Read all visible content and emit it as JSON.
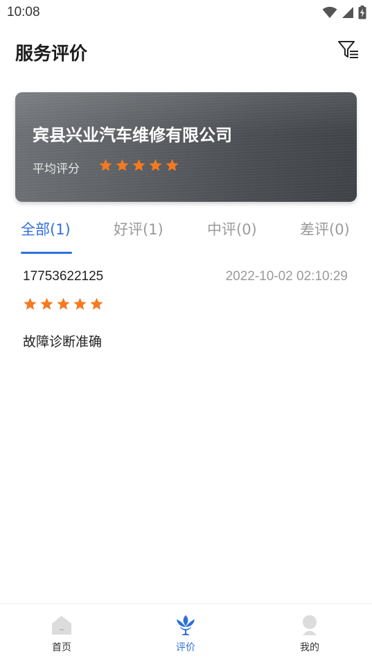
{
  "status_bar": {
    "time": "10:08"
  },
  "header": {
    "title": "服务评价",
    "filter_icon": "filter-icon"
  },
  "store": {
    "name": "宾县兴业汽车维修有限公司",
    "avg_label": "平均评分",
    "rating": 5,
    "max_rating": 5
  },
  "tabs": [
    {
      "label": "全部(1)",
      "active": true
    },
    {
      "label": "好评(1)",
      "active": false
    },
    {
      "label": "中评(0)",
      "active": false
    },
    {
      "label": "差评(0)",
      "active": false
    }
  ],
  "reviews": [
    {
      "user": "17753622125",
      "time": "2022-10-02 02:10:29",
      "rating": 5,
      "text": "故障诊断准确"
    }
  ],
  "nav": [
    {
      "label": "首页",
      "icon": "home-icon",
      "active": false
    },
    {
      "label": "评价",
      "icon": "lotus-icon",
      "active": true
    },
    {
      "label": "我的",
      "icon": "user-icon",
      "active": false
    }
  ],
  "colors": {
    "accent": "#2f6fdc",
    "star": "#f57a1f",
    "inactive_tab": "#9a9a9a"
  }
}
